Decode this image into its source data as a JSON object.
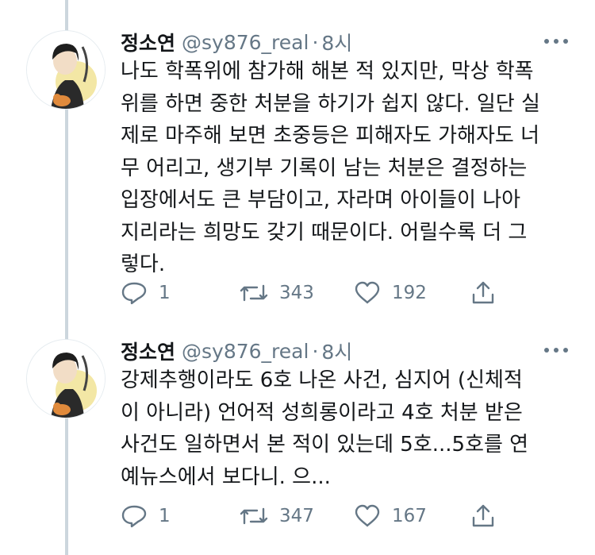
{
  "tweets": [
    {
      "display_name": "정소연",
      "handle": "@sy876_real",
      "separator": "·",
      "time": "8시",
      "lines": [
        "나도 학폭위에 참가해 해본 적 있지만, 막상 학폭",
        "위를 하면 중한 처분을 하기가 쉽지 않다. 일단 실",
        "제로 마주해 보면 초중등은 피해자도 가해자도 너",
        "무 어리고, 생기부 기록이 남는 처분은 결정하는",
        "입장에서도 큰 부담이고, 자라며 아이들이 나아",
        "지리라는 희망도 갖기 때문이다. 어릴수록 더 그",
        "렇다."
      ],
      "replies": "1",
      "retweets": "343",
      "likes": "192"
    },
    {
      "display_name": "정소연",
      "handle": "@sy876_real",
      "separator": "·",
      "time": "8시",
      "lines": [
        "강제추행이라도 6호 나온 사건, 심지어 (신체적",
        "이 아니라) 언어적 성희롱이라고 4호 처분 받은",
        "사건도 일하면서 본 적이 있는데 5호...5호를 연",
        "예뉴스에서 보다니. 으..."
      ],
      "replies": "1",
      "retweets": "347",
      "likes": "167"
    }
  ],
  "icons": {
    "avatar": "profile-avatar-illustration",
    "more": "more-options-caret-icon",
    "reply": "reply-icon",
    "retweet": "retweet-icon",
    "like": "heart-icon",
    "share": "share-icon"
  },
  "colors": {
    "text": "#14171a",
    "secondary": "#657786",
    "thread_line": "#ccd6dd"
  }
}
